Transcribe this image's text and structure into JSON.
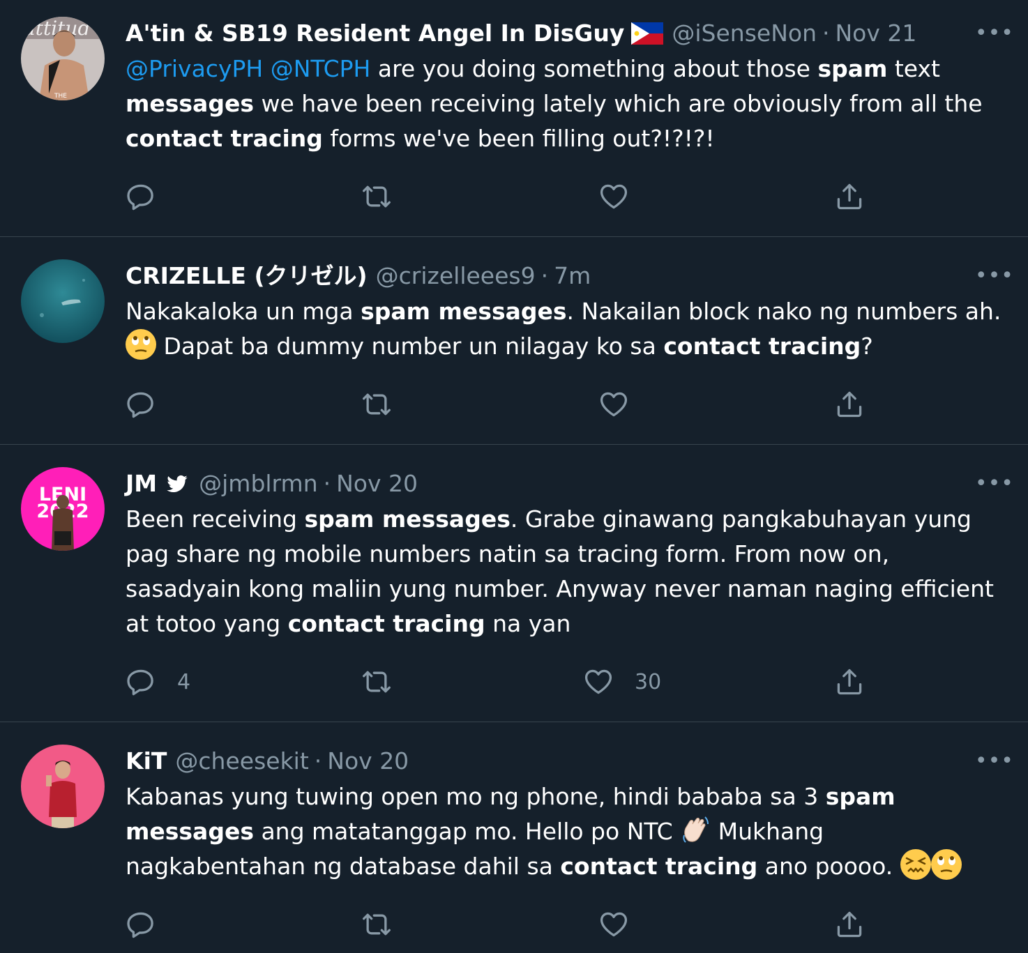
{
  "tweets": [
    {
      "name": "A'tin & SB19 Resident Angel In DisGuy",
      "handle": "@iSenseNon",
      "dot": "·",
      "time": "Nov 21",
      "mention1": "@PrivacyPH",
      "mention2": "@NTCPH",
      "t1": " are you doing something about those ",
      "b1": "spam",
      "t2": " text ",
      "b2": "messages",
      "t3": " we have been receiving lately which are obviously from all the ",
      "b3": "contact tracing",
      "t4": " forms we've been filling out?!?!?!",
      "reply_count": "",
      "like_count": ""
    },
    {
      "name": "CRIZELLE (クリゼル)",
      "handle": "@crizelleees9",
      "dot": "·",
      "time": "7m",
      "t1": "Nakakaloka un mga ",
      "b1": "spam messages",
      "t2": ". Nakailan block nako ng numbers ah. ",
      "t3": " Dapat ba dummy number un nilagay ko sa ",
      "b2": "contact tracing",
      "t4": "?",
      "reply_count": "",
      "like_count": ""
    },
    {
      "name": "JM",
      "handle": "@jmblrmn",
      "dot": "·",
      "time": "Nov 20",
      "avatar_text1": "LENI",
      "avatar_text2": "2022",
      "t1": "Been receiving ",
      "b1": "spam messages",
      "t2": ". Grabe ginawang pangkabuhayan yung pag share ng mobile numbers natin sa tracing form. From now on, sasadyain kong maliin yung number. Anyway never naman naging efficient at totoo yang ",
      "b2": "contact tracing",
      "t3": " na yan",
      "reply_count": "4",
      "like_count": "30"
    },
    {
      "name": "KiT",
      "handle": "@cheesekit",
      "dot": "·",
      "time": "Nov 20",
      "t1": "Kabanas yung tuwing open mo ng phone, hindi bababa sa 3 ",
      "b1": "spam messages",
      "t2": " ang matatanggap mo. Hello po NTC ",
      "t3": " Mukhang nagkabentahan ng database dahil sa ",
      "b2": "contact tracing",
      "t4": " ano poooo. ",
      "reply_count": "",
      "like_count": ""
    }
  ],
  "more_label": "•••",
  "colors": {
    "background": "#15202b",
    "mention": "#1d9bf0",
    "muted": "#8899a6",
    "avatar3": "#ff1fb8",
    "avatar4": "#f25a87"
  },
  "icons": [
    "reply-icon",
    "retweet-icon",
    "like-icon",
    "share-icon",
    "more-icon",
    "philippine-flag-icon",
    "twitter-bird-icon"
  ]
}
